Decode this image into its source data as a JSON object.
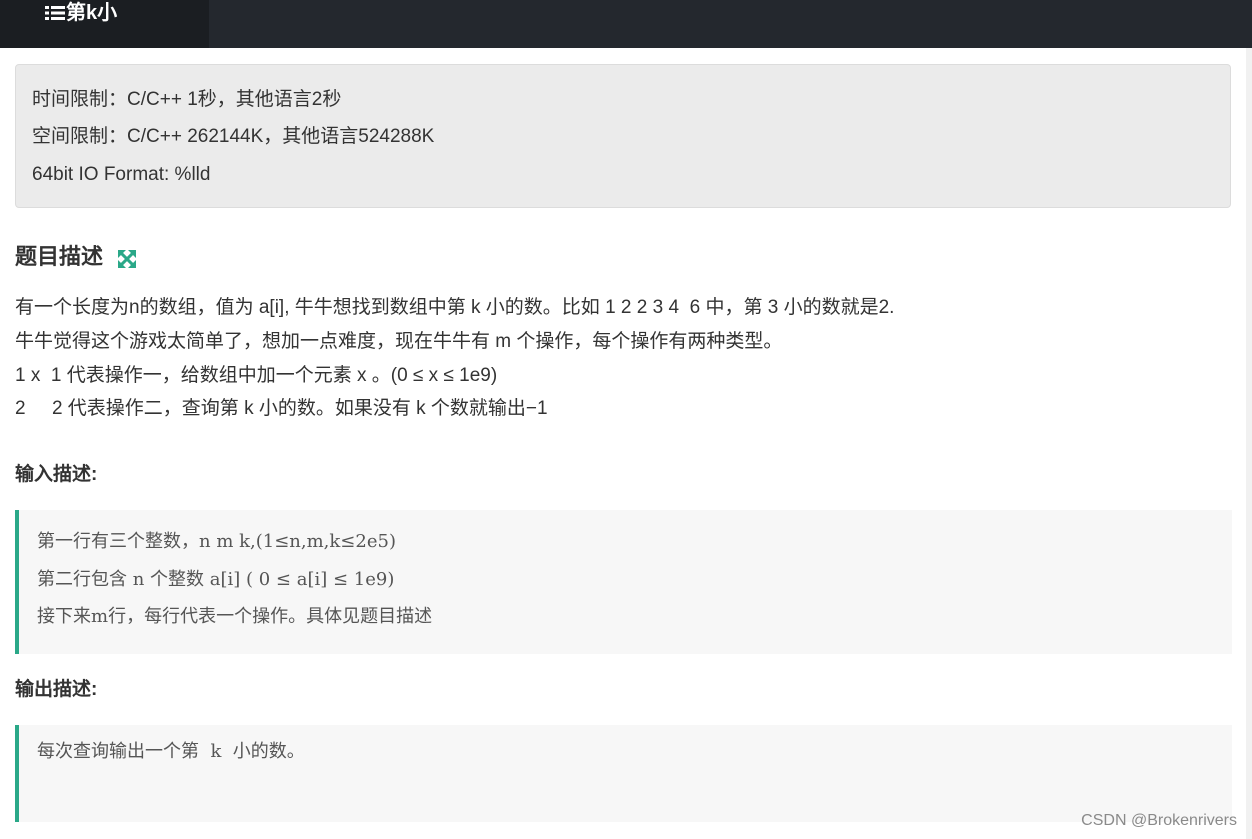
{
  "header": {
    "icon": "list-icon",
    "title": "第k小"
  },
  "limits": {
    "time": "时间限制：C/C++ 1秒，其他语言2秒",
    "space": "空间限制：C/C++ 262144K，其他语言524288K",
    "io_format": "64bit IO Format: %lld"
  },
  "description": {
    "heading": "题目描述",
    "expand_icon": "expand-icon",
    "lines": [
      "有一个长度为n的数组，值为 a[i], 牛牛想找到数组中第 k 小的数。比如 1 2 2 3 4  6 中，第 3 小的数就是2.",
      "牛牛觉得这个游戏太简单了，想加一点难度，现在牛牛有 m 个操作，每个操作有两种类型。",
      "1 x  1 代表操作一，给数组中加一个元素 x 。(0 ≤ x ≤ 1e9)",
      "2     2 代表操作二，查询第 k 小的数。如果没有 k 个数就输出−1"
    ]
  },
  "input": {
    "heading": "输入描述:",
    "lines": [
      "第一行有三个整数，n m k,(1≤n,m,k≤2e5)",
      "第二行包含 n 个整数 a[i] ( 0 ≤ a[i] ≤ 1e9)",
      "接下来m行，每行代表一个操作。具体见题目描述"
    ]
  },
  "output": {
    "heading": "输出描述:",
    "lines": [
      "每次查询输出一个第  k  小的数。"
    ]
  },
  "watermark": "CSDN @Brokenrivers",
  "colors": {
    "topbar": "#24282e",
    "accent": "#2aa888",
    "panel": "#ebebeb"
  }
}
